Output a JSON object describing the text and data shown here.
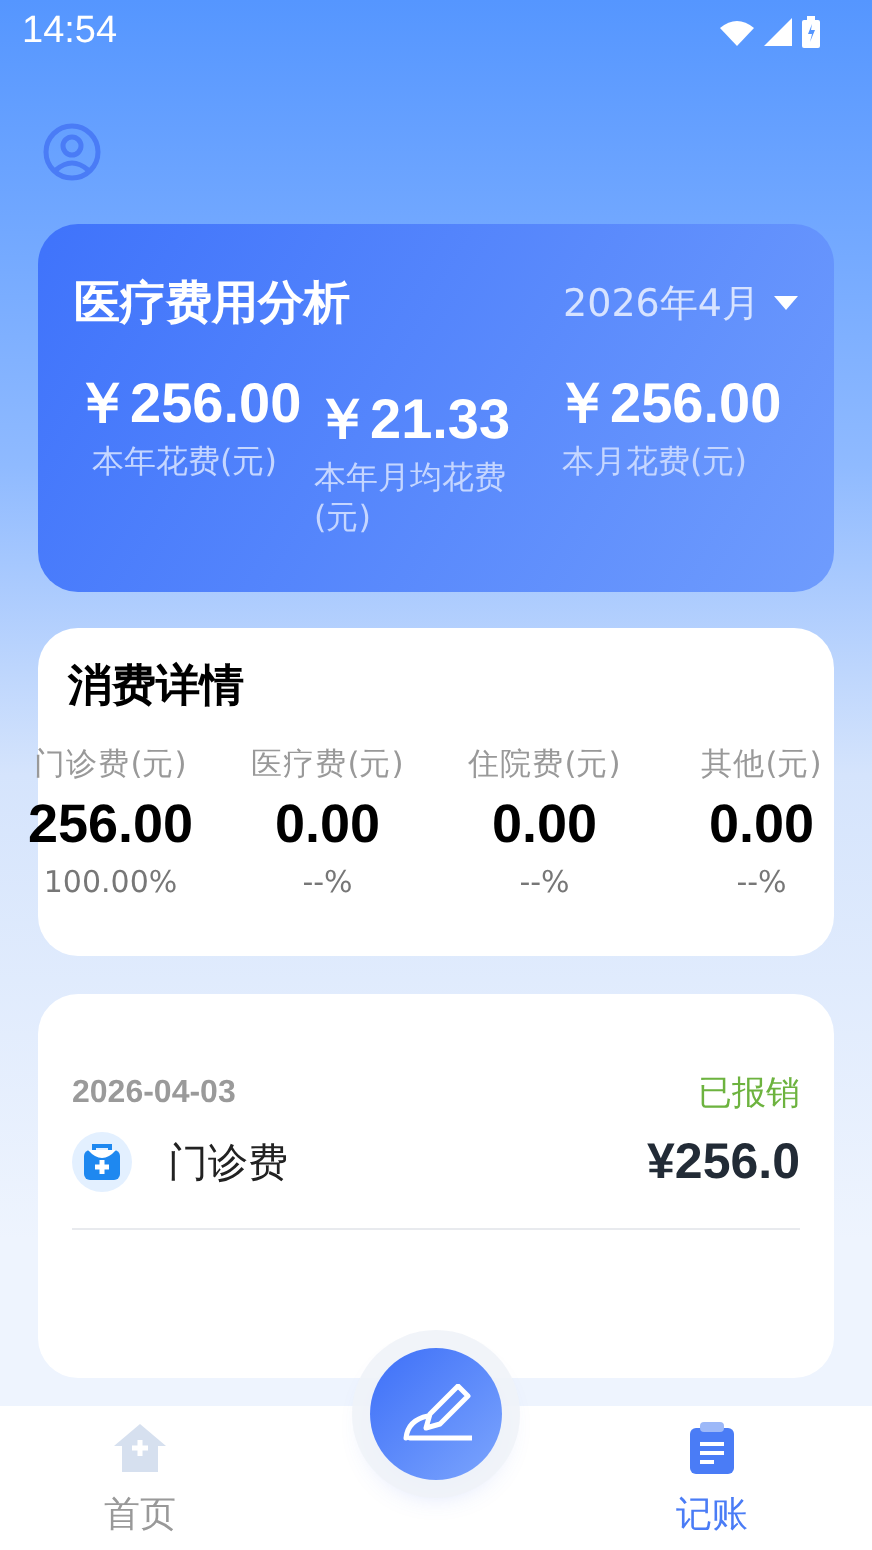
{
  "status_bar": {
    "time": "14:54"
  },
  "analysis": {
    "title": "医疗费用分析",
    "month": "2026年4月",
    "stats": [
      {
        "value": "￥256.00",
        "label": "本年花费(元)"
      },
      {
        "value": "￥21.33",
        "label": "本年月均花费(元)"
      },
      {
        "value": "￥256.00",
        "label": "本月花费(元)"
      }
    ]
  },
  "details": {
    "title": "消费详情",
    "categories": [
      {
        "label": "门诊费(元)",
        "amount": "256.00",
        "percent": "100.00%"
      },
      {
        "label": "医疗费(元)",
        "amount": "0.00",
        "percent": "--%"
      },
      {
        "label": "住院费(元)",
        "amount": "0.00",
        "percent": "--%"
      },
      {
        "label": "其他(元)",
        "amount": "0.00",
        "percent": "--%"
      }
    ]
  },
  "records": [
    {
      "date": "2026-04-03",
      "status": "已报销",
      "category": "门诊费",
      "amount": "¥256.0"
    }
  ],
  "tab_bar": [
    {
      "label": "首页",
      "selected": false,
      "kind": "home"
    },
    {
      "label": "记账",
      "selected": true,
      "kind": "ledger"
    }
  ]
}
